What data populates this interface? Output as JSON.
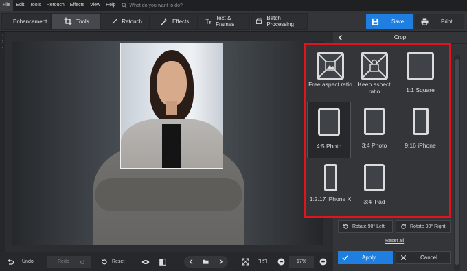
{
  "menu": {
    "items": [
      "File",
      "Edit",
      "Tools",
      "Retouch",
      "Effects",
      "View",
      "Help"
    ],
    "search_placeholder": "What do you want to do?"
  },
  "toolbar": {
    "tabs": [
      {
        "label": "Enhancement",
        "icon": "sliders-icon"
      },
      {
        "label": "Tools",
        "icon": "crop-icon"
      },
      {
        "label": "Retouch",
        "icon": "brush-icon"
      },
      {
        "label": "Effects",
        "icon": "magic-wand-icon"
      },
      {
        "label": "Text & Frames",
        "icon": "text-icon"
      },
      {
        "label": "Batch Processing",
        "icon": "batch-icon"
      }
    ],
    "active_tab": "Tools",
    "save_label": "Save",
    "print_label": "Print"
  },
  "panel": {
    "title": "Crop",
    "options": [
      {
        "label": "Free aspect ratio",
        "icon": "free-aspect-icon"
      },
      {
        "label": "Keep aspect ratio",
        "icon": "keep-aspect-icon"
      },
      {
        "label": "1:1 Square",
        "icon": "square-icon"
      },
      {
        "label": "4:5 Photo",
        "icon": "photo-4-5-icon"
      },
      {
        "label": "3:4 Photo",
        "icon": "photo-3-4-icon"
      },
      {
        "label": "9:16 iPhone",
        "icon": "iphone-9-16-icon"
      },
      {
        "label": "1:2.17 iPhone X",
        "icon": "iphone-x-icon"
      },
      {
        "label": "3:4 iPad",
        "icon": "ipad-icon"
      }
    ],
    "selected_option": "4:5 Photo",
    "rotate_left_label": "Rotate 90° Left",
    "rotate_right_label": "Rotate 90° Right",
    "reset_all_label": "Reset all",
    "apply_label": "Apply",
    "cancel_label": "Cancel"
  },
  "bottom": {
    "undo_label": "Undo",
    "redo_label": "Redo",
    "reset_label": "Reset",
    "ratio_label": "1:1",
    "zoom_value": "17%"
  },
  "colors": {
    "accent": "#1e7fe0",
    "highlight_border": "#e0141c",
    "panel_bg": "#333538"
  }
}
